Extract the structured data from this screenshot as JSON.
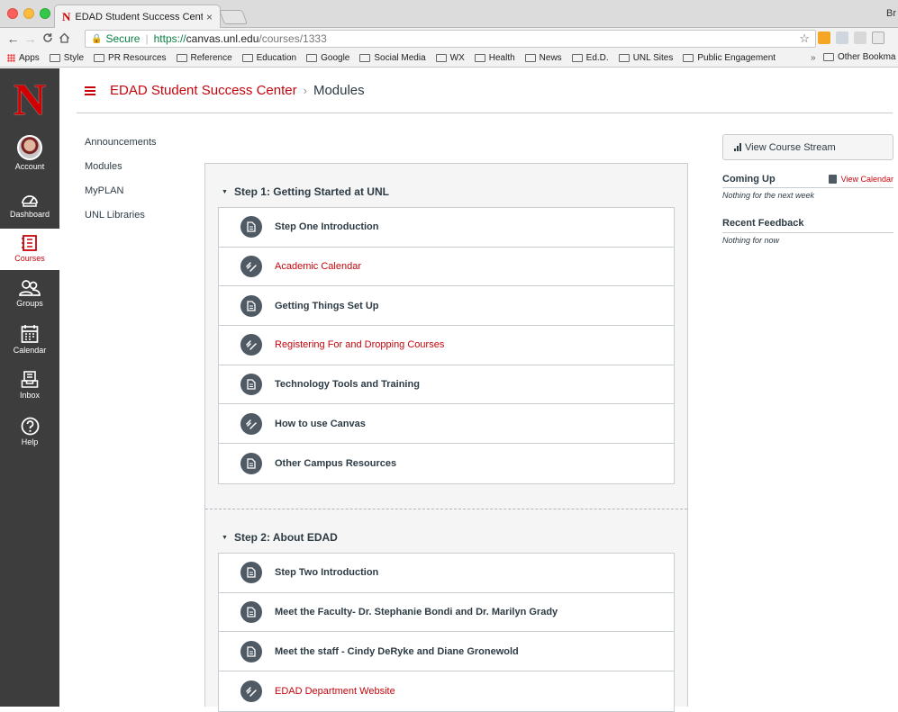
{
  "browser": {
    "tab_title": "EDAD Student Success Center",
    "tab_close": "×",
    "favicon_letter": "N",
    "profile": "Br",
    "secure_label": "Secure",
    "url_scheme": "https://",
    "url_host": "canvas.unl.edu",
    "url_path": "/courses/1333",
    "bookmarks": [
      "Apps",
      "Style",
      "PR Resources",
      "Reference",
      "Education",
      "Google",
      "Social Media",
      "WX",
      "Health",
      "News",
      "Ed.D.",
      "UNL Sites",
      "Public Engagement"
    ],
    "more_bookmarks": "»",
    "other_bookmarks": "Other Bookma"
  },
  "global_nav": {
    "logo": "N",
    "account": "Account",
    "dashboard": "Dashboard",
    "courses": "Courses",
    "groups": "Groups",
    "calendar": "Calendar",
    "inbox": "Inbox",
    "help": "Help"
  },
  "header": {
    "course_name": "EDAD Student Success Center",
    "separator": "›",
    "current_page": "Modules"
  },
  "course_nav": [
    "Announcements",
    "Modules",
    "MyPLAN",
    "UNL Libraries"
  ],
  "modules": [
    {
      "title": "Step 1: Getting Started at UNL",
      "items": [
        {
          "label": "Step One Introduction",
          "type": "page"
        },
        {
          "label": "Academic Calendar",
          "type": "link"
        },
        {
          "label": "Getting Things Set Up",
          "type": "page"
        },
        {
          "label": "Registering For and Dropping Courses",
          "type": "link"
        },
        {
          "label": "Technology Tools and Training",
          "type": "page"
        },
        {
          "label": "How to use Canvas",
          "type": "link"
        },
        {
          "label": "Other Campus Resources",
          "type": "page"
        }
      ]
    },
    {
      "title": "Step 2: About EDAD",
      "items": [
        {
          "label": "Step Two Introduction",
          "type": "page"
        },
        {
          "label": "Meet the Faculty- Dr. Stephanie Bondi and Dr. Marilyn Grady",
          "type": "page"
        },
        {
          "label": "Meet the staff - Cindy DeRyke and Diane Gronewold",
          "type": "page"
        },
        {
          "label": "EDAD Department Website",
          "type": "link"
        }
      ]
    }
  ],
  "sidebar": {
    "stream_button": "View Course Stream",
    "coming_up": "Coming Up",
    "view_calendar": "View Calendar",
    "coming_up_note": "Nothing for the next week",
    "recent_feedback": "Recent Feedback",
    "feedback_note": "Nothing for now"
  },
  "colors": {
    "accent": "#c5050c",
    "nav_bg": "#3d3d3d",
    "icon_circle": "#4f5a65"
  }
}
